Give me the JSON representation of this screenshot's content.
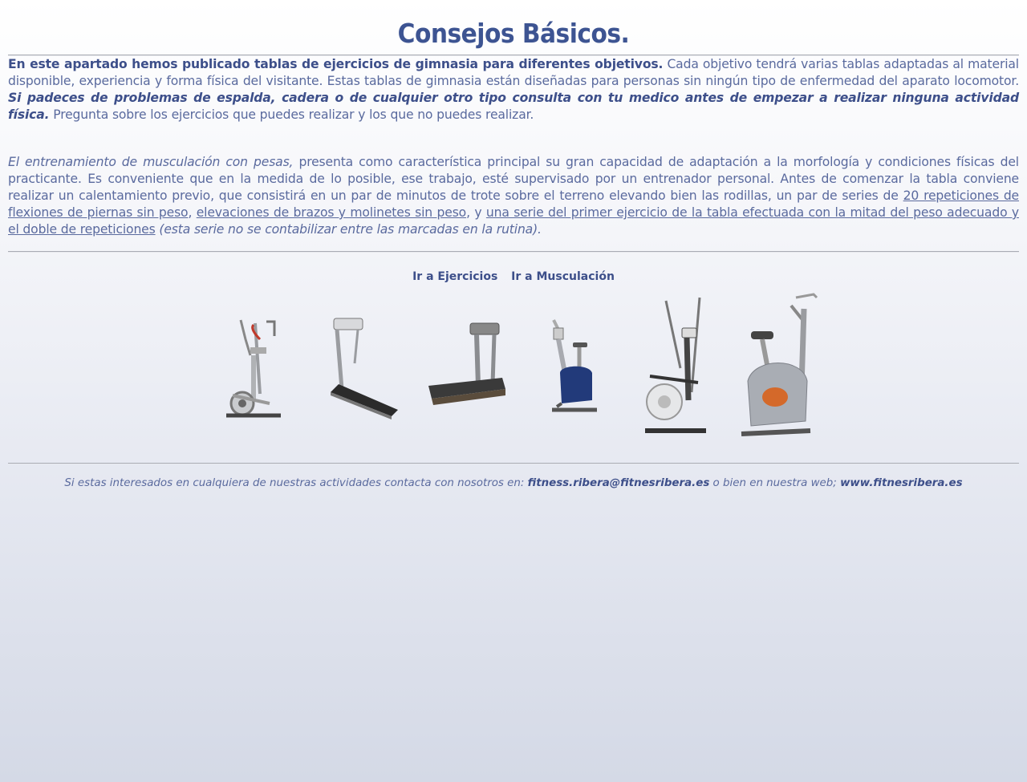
{
  "title": "Consejos Básicos.",
  "intro": {
    "bold": "En este apartado hemos publicado tablas de ejercicios de gimnasia para diferentes objetivos.",
    "normal": " Cada objetivo tendrá varias tablas adaptadas al material disponible, experiencia y forma física del visitante. Estas tablas de gimnasia están diseñadas para personas sin ningún tipo de enfermedad del aparato locomotor. ",
    "warning": "Si padeces de problemas de espalda, cadera o de cualquier otro tipo consulta con tu medico antes de empezar a realizar ninguna actividad física.",
    "tail": " Pregunta sobre los ejercicios que puedes realizar y los que no puedes realizar."
  },
  "training": {
    "italic_lead": "El entrenamiento de musculación con pesas,",
    "text1": " presenta como característica principal su gran capacidad de adaptación a la morfología y condiciones físicas del practicante. Es conveniente que en la medida de lo posible, ese trabajo, esté supervisado por un entrenador personal. Antes de comenzar la tabla conviene realizar un calentamiento previo, que consistirá en un par de minutos de trote sobre el terreno elevando bien las rodillas, un par de series de ",
    "link1": "20 repeticiones de flexiones de piernas sin peso",
    "sep1": ", ",
    "link2": "elevaciones de brazos y molinetes sin peso",
    "sep2": ", y ",
    "link3": "una serie del primer ejercicio de la tabla efectuada con la mitad del peso adecuado y el doble de repeticiones",
    "italic_tail": " (esta serie no se contabilizar entre las marcadas en la rutina)."
  },
  "nav": {
    "ejercicios": "Ir a Ejercicios",
    "musculacion": "Ir a Musculación"
  },
  "gallery": [
    "elliptical-trainer",
    "treadmill",
    "treadmill",
    "exercise-bike",
    "elliptical-trainer",
    "exercise-bike"
  ],
  "footer": {
    "text1": "Si estas interesados en cualquiera de nuestras actividades contacta con nosotros en: ",
    "email": "fitness.ribera@fitnesribera.es",
    "text2": " o bien en nuestra web; ",
    "web": "www.fitnesribera.es"
  }
}
